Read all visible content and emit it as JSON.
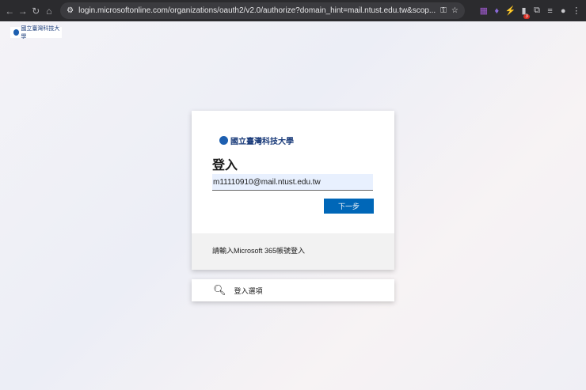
{
  "browser": {
    "url": "login.microsoftonline.com/organizations/oauth2/v2.0/authorize?domain_hint=mail.ntust.edu.tw&scop...",
    "ext_badge": "3"
  },
  "org": {
    "name": "國立臺灣科技大學"
  },
  "signin": {
    "title": "登入",
    "email": "m11110910@mail.ntust.edu.tw",
    "next_label": "下一步",
    "footer": "請輸入Microsoft 365帳號登入"
  },
  "options": {
    "label": "登入選項"
  }
}
